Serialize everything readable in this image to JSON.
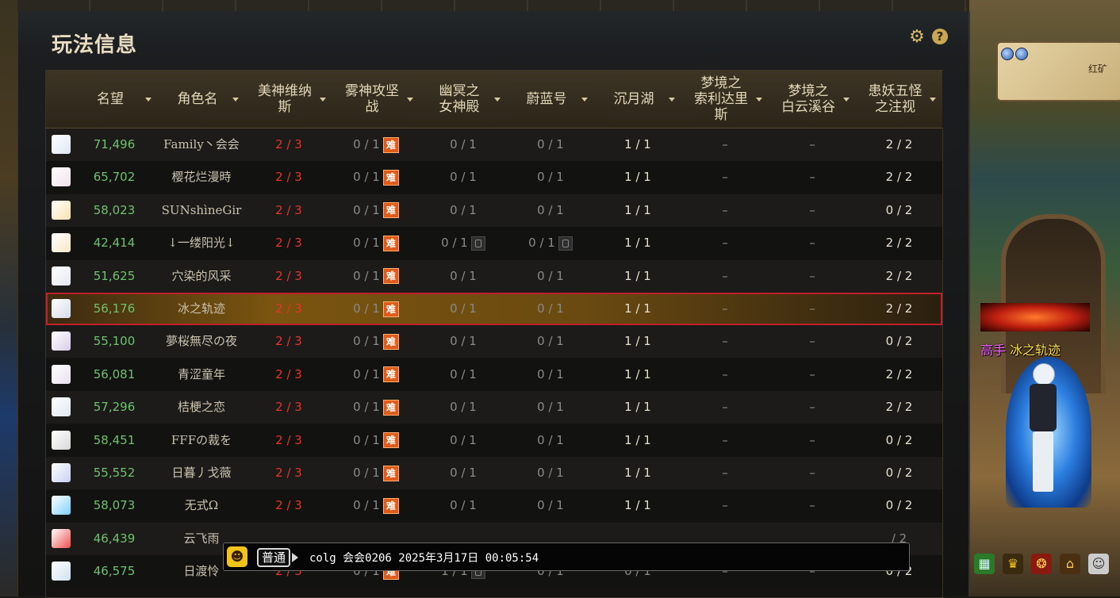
{
  "panel": {
    "title": "玩法信息"
  },
  "columns": [
    {
      "label": "名望"
    },
    {
      "label": "角色名"
    },
    {
      "label": "美神维纳\n斯"
    },
    {
      "label": "雾神攻坚\n战"
    },
    {
      "label": "幽冥之\n女神殿"
    },
    {
      "label": "蔚蓝号"
    },
    {
      "label": "沉月湖"
    },
    {
      "label": "梦境之\n索利达里\n斯"
    },
    {
      "label": "梦境之\n白云溪谷"
    },
    {
      "label": "患妖五怪\n之注视"
    }
  ],
  "rows": [
    {
      "fame": "71,496",
      "name": "Family丶会会",
      "c1": "2 / 3",
      "c2": "0 / 1",
      "c3": "0 / 1",
      "c4": "0 / 1",
      "c5": "1 / 1",
      "c6": "–",
      "c7": "–",
      "c8": "2 / 2"
    },
    {
      "fame": "65,702",
      "name": "樱花烂漫時",
      "c1": "2 / 3",
      "c2": "0 / 1",
      "c3": "0 / 1",
      "c4": "0 / 1",
      "c5": "1 / 1",
      "c6": "–",
      "c7": "–",
      "c8": "2 / 2"
    },
    {
      "fame": "58,023",
      "name": "SUNshìneGir",
      "c1": "2 / 3",
      "c2": "0 / 1",
      "c3": "0 / 1",
      "c4": "0 / 1",
      "c5": "1 / 1",
      "c6": "–",
      "c7": "–",
      "c8": "0 / 2"
    },
    {
      "fame": "42,414",
      "name": "↓一缕阳光↓",
      "c1": "2 / 3",
      "c2": "0 / 1",
      "c3": "0 / 1",
      "c4": "0 / 1",
      "c5": "1 / 1",
      "c6": "–",
      "c7": "–",
      "c8": "2 / 2"
    },
    {
      "fame": "51,625",
      "name": "穴染的风采",
      "c1": "2 / 3",
      "c2": "0 / 1",
      "c3": "0 / 1",
      "c4": "0 / 1",
      "c5": "1 / 1",
      "c6": "–",
      "c7": "–",
      "c8": "2 / 2"
    },
    {
      "fame": "56,176",
      "name": "冰之轨迹",
      "c1": "2 / 3",
      "c2": "0 / 1",
      "c3": "0 / 1",
      "c4": "0 / 1",
      "c5": "1 / 1",
      "c6": "–",
      "c7": "–",
      "c8": "2 / 2"
    },
    {
      "fame": "55,100",
      "name": "夢桜無尽の夜",
      "c1": "2 / 3",
      "c2": "0 / 1",
      "c3": "0 / 1",
      "c4": "0 / 1",
      "c5": "1 / 1",
      "c6": "–",
      "c7": "–",
      "c8": "0 / 2"
    },
    {
      "fame": "56,081",
      "name": "青涩童年",
      "c1": "2 / 3",
      "c2": "0 / 1",
      "c3": "0 / 1",
      "c4": "0 / 1",
      "c5": "1 / 1",
      "c6": "–",
      "c7": "–",
      "c8": "2 / 2"
    },
    {
      "fame": "57,296",
      "name": "桔梗之恋",
      "c1": "2 / 3",
      "c2": "0 / 1",
      "c3": "0 / 1",
      "c4": "0 / 1",
      "c5": "1 / 1",
      "c6": "–",
      "c7": "–",
      "c8": "2 / 2"
    },
    {
      "fame": "58,451",
      "name": "FFFの裁を",
      "c1": "2 / 3",
      "c2": "0 / 1",
      "c3": "0 / 1",
      "c4": "0 / 1",
      "c5": "1 / 1",
      "c6": "–",
      "c7": "–",
      "c8": "0 / 2"
    },
    {
      "fame": "55,552",
      "name": "日暮丿戈薇",
      "c1": "2 / 3",
      "c2": "0 / 1",
      "c3": "0 / 1",
      "c4": "0 / 1",
      "c5": "1 / 1",
      "c6": "–",
      "c7": "–",
      "c8": "0 / 2"
    },
    {
      "fame": "58,073",
      "name": "无式Ω",
      "c1": "2 / 3",
      "c2": "0 / 1",
      "c3": "0 / 1",
      "c4": "0 / 1",
      "c5": "1 / 1",
      "c6": "–",
      "c7": "–",
      "c8": "0 / 2"
    },
    {
      "fame": "46,439",
      "name": "云飞雨",
      "c1": "",
      "c2": "",
      "c3": "",
      "c4": "",
      "c5": "",
      "c6": "",
      "c7": "",
      "c8": "/ 2"
    },
    {
      "fame": "46,575",
      "name": "日渡怜",
      "c1": "2 / 3",
      "c2": "0 / 1",
      "c3": "1 / 1",
      "c4": "0 / 1",
      "c5": "0 / 1",
      "c6": "–",
      "c7": "–",
      "c8": "0 / 2"
    }
  ],
  "badges": {
    "hard": "难"
  },
  "chat": {
    "channel": "普通",
    "text": "colg 会会0206 2025年3月17日 00:05:54"
  },
  "side": {
    "map_label": "红矿",
    "char_title_prefix": "高手",
    "char_name": "冰之轨迹"
  },
  "colors": {
    "fame": "#6fc16f",
    "progress_red": "#e0362e",
    "highlight_border": "#c0202a"
  }
}
